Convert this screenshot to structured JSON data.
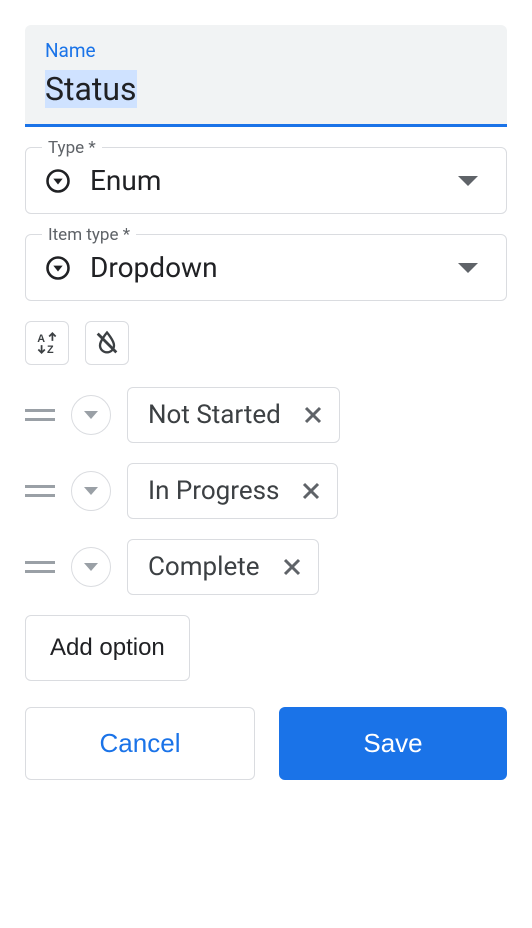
{
  "name_field": {
    "label": "Name",
    "value": "Status"
  },
  "type_field": {
    "label": "Type *",
    "value": "Enum"
  },
  "item_type_field": {
    "label": "Item type *",
    "value": "Dropdown"
  },
  "options": [
    {
      "label": "Not Started"
    },
    {
      "label": "In Progress"
    },
    {
      "label": "Complete"
    }
  ],
  "add_option": "Add option",
  "buttons": {
    "cancel": "Cancel",
    "save": "Save"
  }
}
